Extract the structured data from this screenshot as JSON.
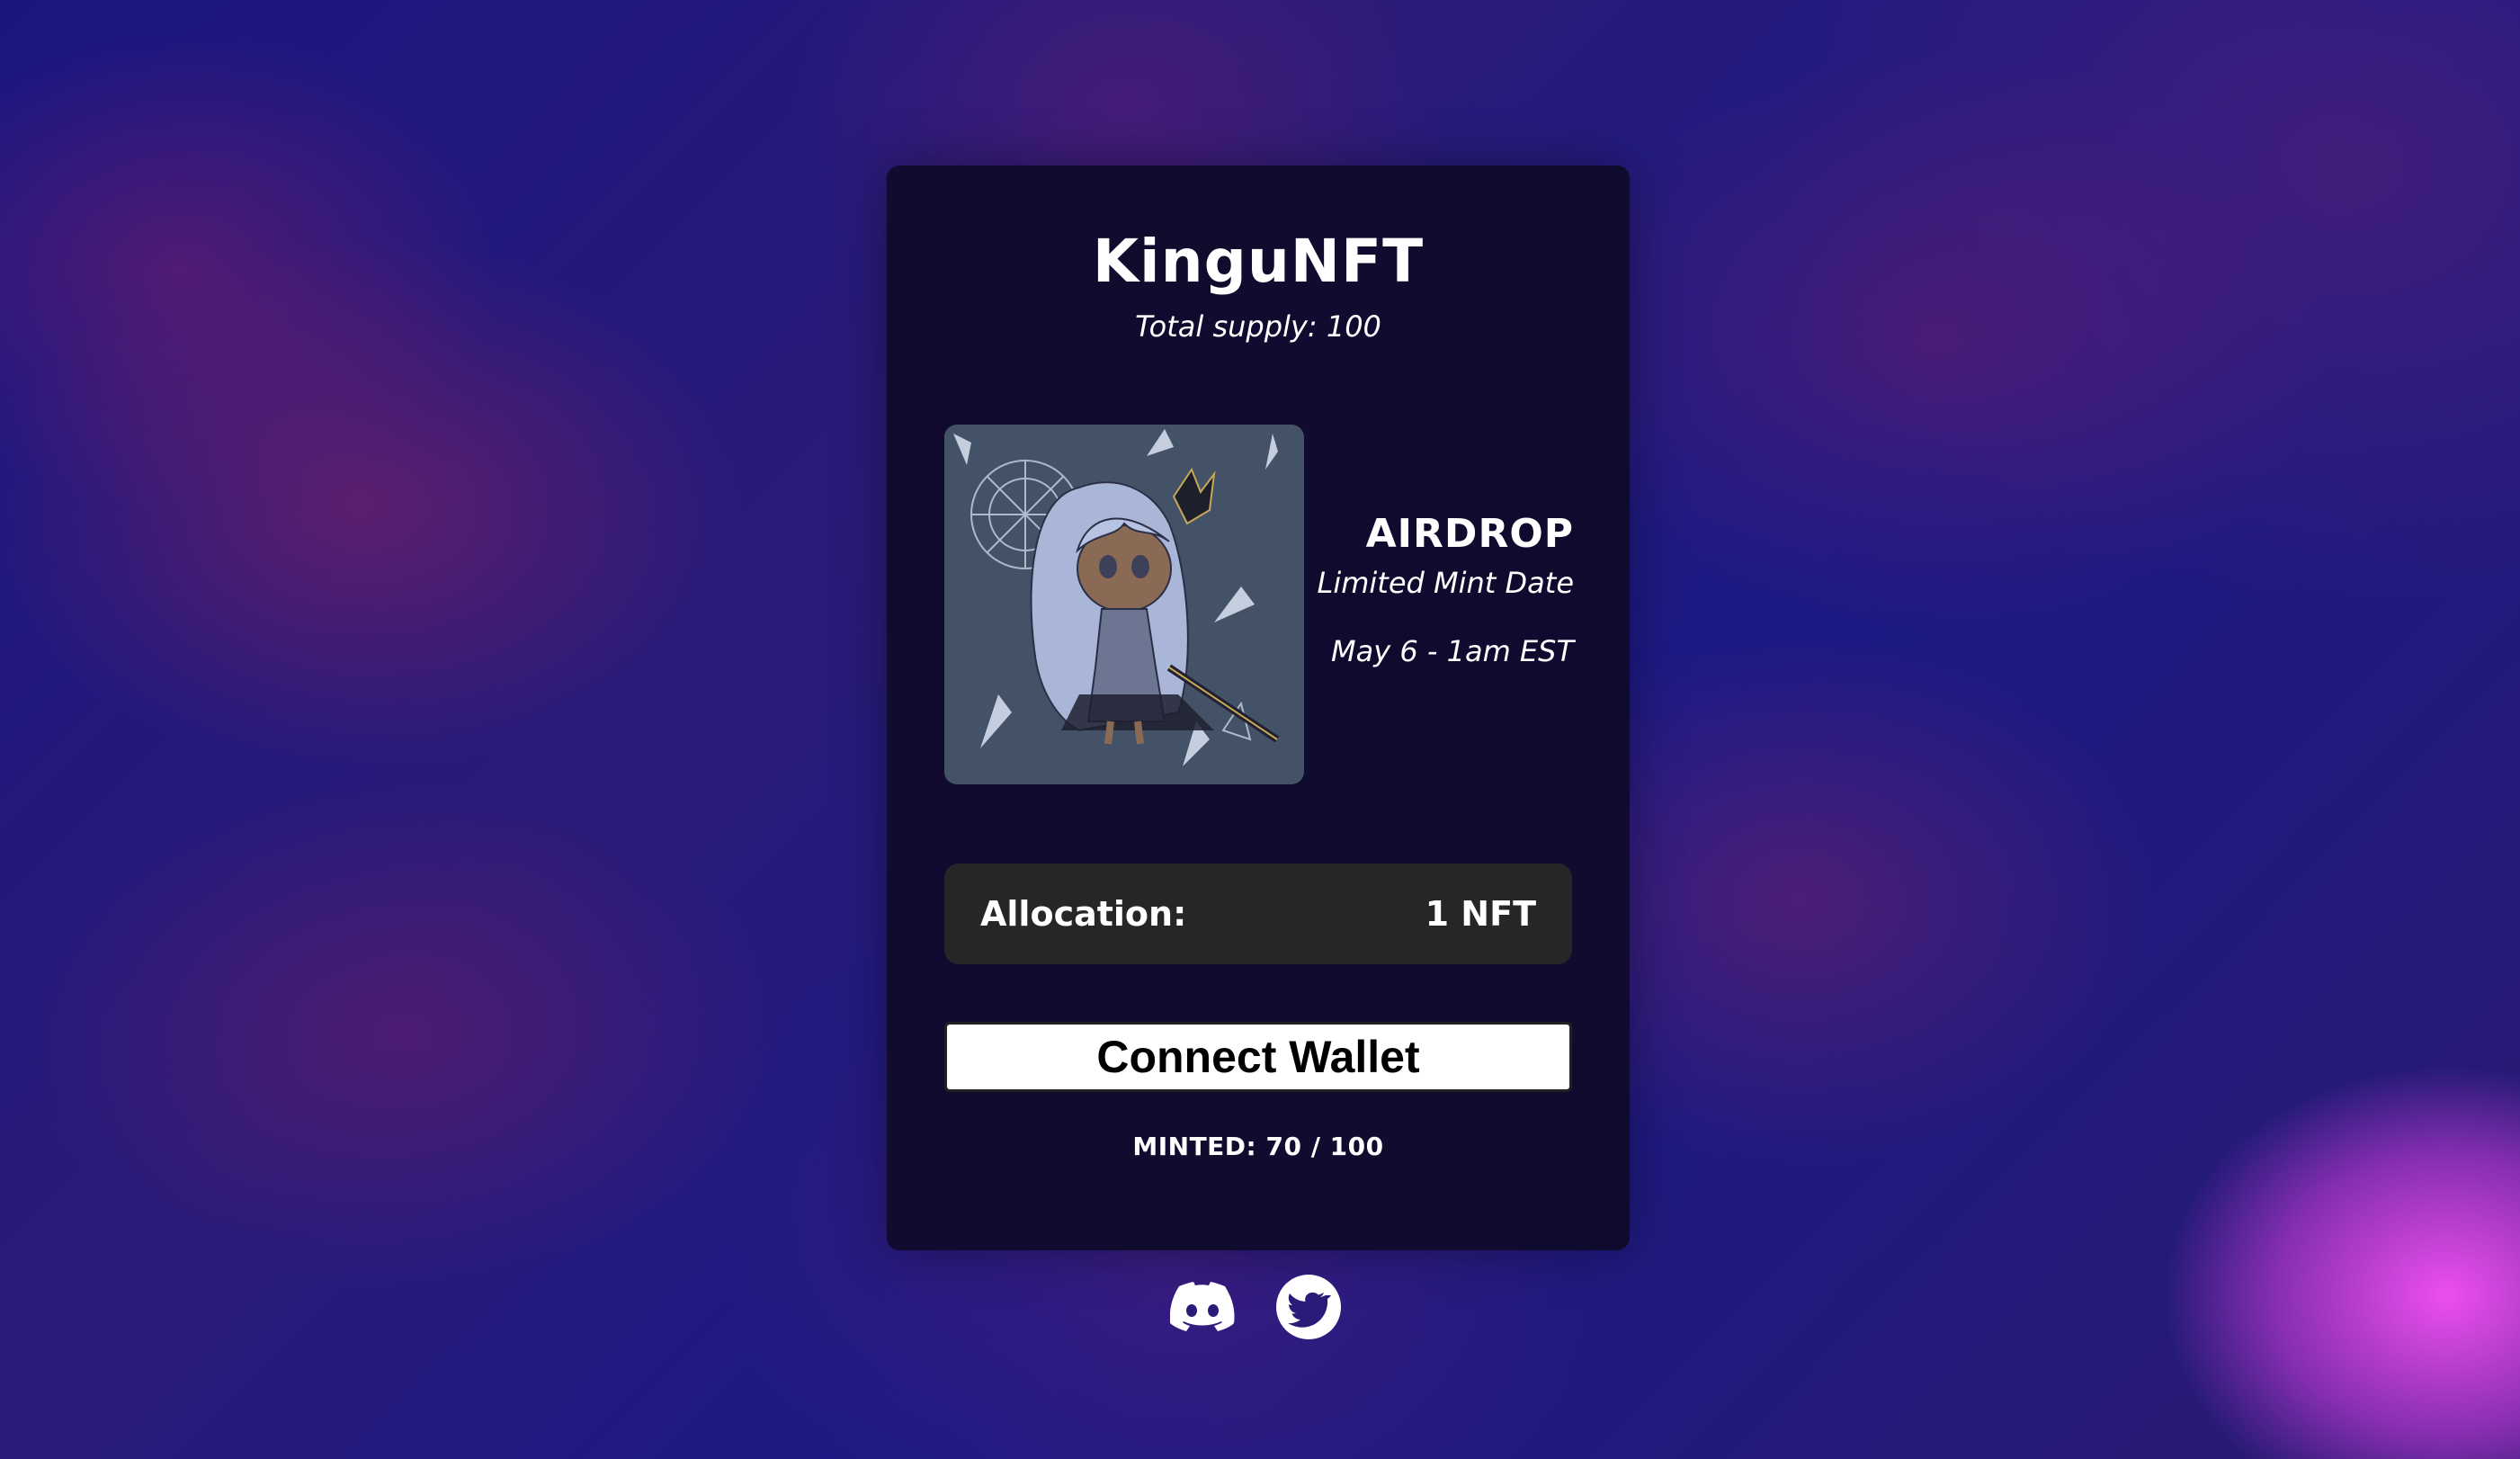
{
  "project": {
    "title": "KinguNFT",
    "supply_text": "Total supply: 100"
  },
  "airdrop": {
    "heading": "AIRDROP",
    "subtitle": "Limited Mint Date",
    "date": "May 6 - 1am EST"
  },
  "allocation": {
    "label": "Allocation:",
    "value": "1 NFT"
  },
  "connect_button": {
    "label": "Connect Wallet"
  },
  "minted": {
    "text": "MINTED: 70 / 100"
  },
  "socials": {
    "discord": "discord-icon",
    "twitter": "twitter-icon"
  },
  "colors": {
    "card_bg": "#0e0a28",
    "image_bg": "#435266",
    "allocation_bg": "#262626",
    "button_bg": "#ffffff",
    "glow_accent": "#f050f0"
  }
}
